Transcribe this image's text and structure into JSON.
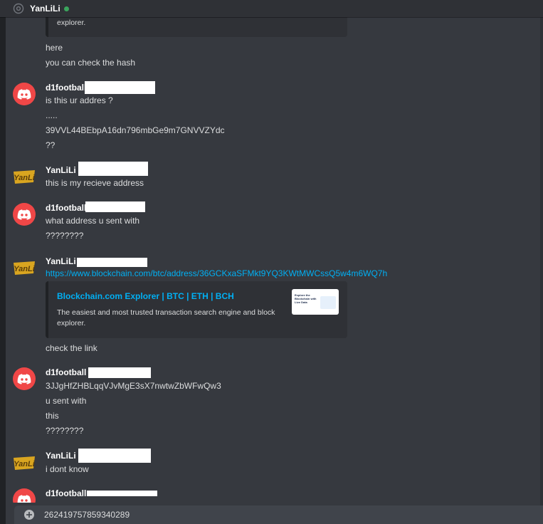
{
  "header": {
    "recipient_name": "YanLiLi",
    "status_color": "#3ba55d"
  },
  "messages": {
    "top_embed_tail": "explorer.",
    "msg_here": "here",
    "msg_check_hash": "you can check the hash",
    "g1_user": "d1football",
    "g1_l1": "is this ur addres ?",
    "g1_l2": ".....",
    "g1_l3": "39VVL44BEbpA16dn796mbGe9m7GNVVZYdc",
    "g1_l4": "??",
    "g2_user": "YanLiLi",
    "g2_l1": "this is my recieve address",
    "g3_user": "d1football",
    "g3_l1": "what address u sent with",
    "g3_l2": "????????",
    "g4_user": "YanLiLi",
    "g4_link": "https://www.blockchain.com/btc/address/36GCKxaSFMkt9YQ3KWtMWCssQ5w4m6WQ7h",
    "g4_embed_title": "Blockchain.com Explorer | BTC | ETH | BCH",
    "g4_embed_desc": "The easiest and most trusted transaction search engine and block explorer.",
    "g4_thumb_text": "Explore the Blockchain with Live Data",
    "g4_l2": "check the link",
    "g5_user": "d1football",
    "g5_l1": "3JJgHfZHBLqqVJvMgE3sX7nwtwZbWFwQw3",
    "g5_l2": "u sent with",
    "g5_l3": "this",
    "g5_l4": "????????",
    "g6_user": "YanLiLi",
    "g6_l1": "i dont know",
    "g7_user": "d1football"
  },
  "composer": {
    "value": "262419757859340289"
  },
  "colors": {
    "background": "#36393f",
    "header": "#2f3136",
    "link": "#00b0f4",
    "discord_avatar": "#f04747",
    "embed_bg": "#2f3136",
    "input_bg": "#40444b"
  }
}
